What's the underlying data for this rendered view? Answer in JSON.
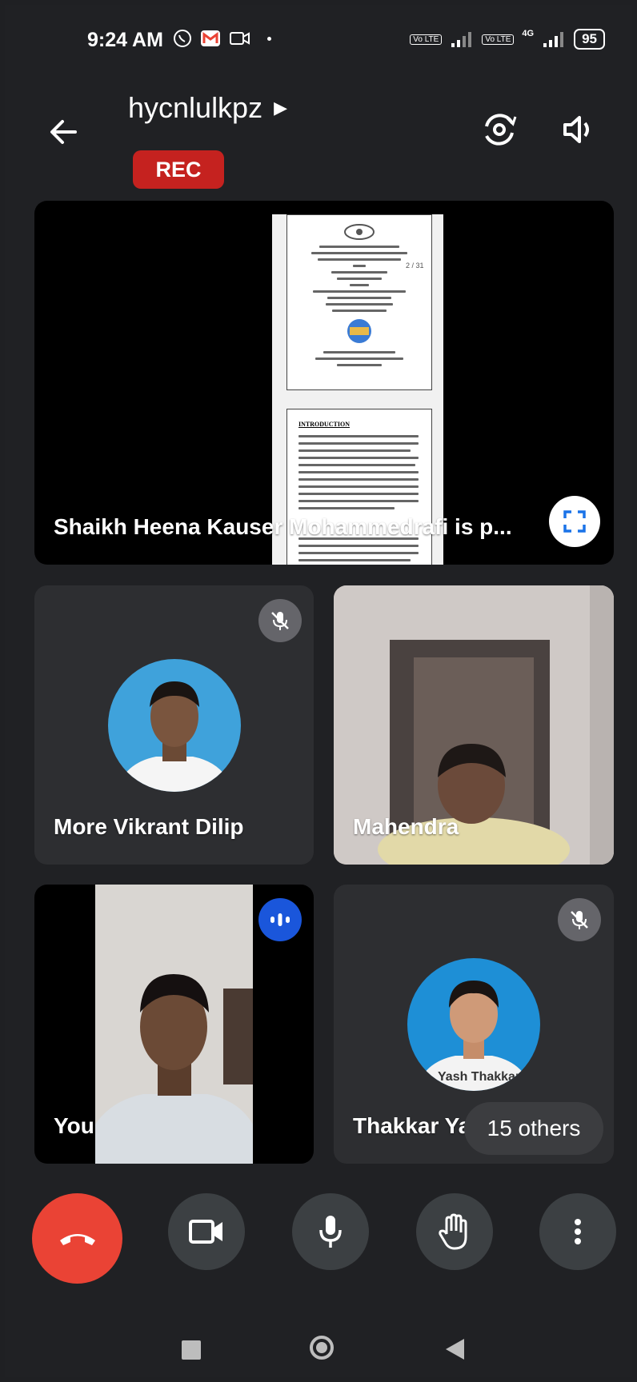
{
  "status_bar": {
    "time": "9:24 AM",
    "battery": "95",
    "network_labels": [
      "Vo LTE",
      "Vo LTE",
      "4G"
    ]
  },
  "header": {
    "meeting_code": "hycnlulkpz",
    "rec_label": "REC"
  },
  "presentation": {
    "presenter_label": "Shaikh Heena Kauser Mohammedrafi is p...",
    "page_indicator": "2 / 31",
    "doc_heading": "INTRODUCTION"
  },
  "participants": [
    {
      "name": "More Vikrant Dilip",
      "muted": true
    },
    {
      "name": "Mahendra",
      "muted": false
    },
    {
      "name": "You",
      "muted": false,
      "speaking": true
    },
    {
      "name": "Thakkar Yash Bipin",
      "visible_name": "Thakkar Yas",
      "muted": true,
      "avatar_caption": "Yash Thakkar"
    }
  ],
  "others_label": "15 others",
  "colors": {
    "background": "#202124",
    "tile": "#2d2e31",
    "rec": "#c5221f",
    "hangup": "#ea4335",
    "speaking": "#1a56db"
  }
}
